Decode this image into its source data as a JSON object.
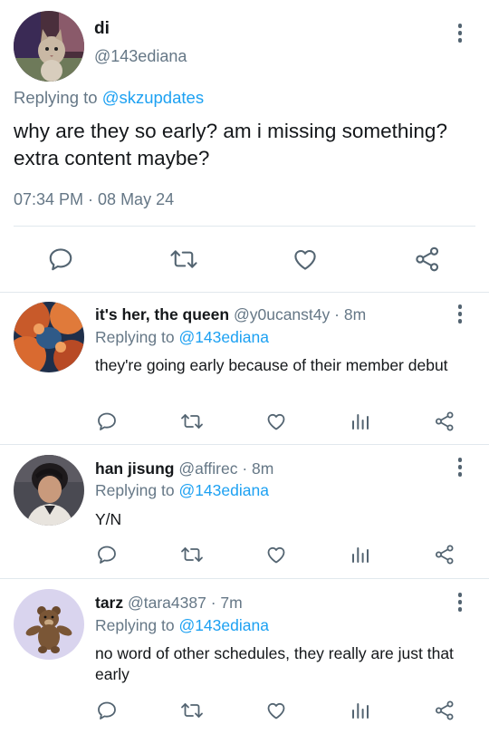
{
  "main_tweet": {
    "avatar_icon": "cat-avatar",
    "name": "di",
    "handle": "@143ediana",
    "replying_prefix": "Replying to",
    "replying_to": "@skzupdates",
    "text": "why are they so early? am i missing something? extra content maybe?",
    "time": "07:34 PM · 08 May 24",
    "actions": [
      "reply-icon",
      "retweet-icon",
      "like-icon",
      "share-icon"
    ]
  },
  "replies": [
    {
      "avatar_icon": "sunset-clouds-avatar",
      "name": "it's her, the queen",
      "handle": "@y0ucanst4y",
      "age": "· 8m",
      "replying_prefix": "Replying to",
      "replying_to": "@143ediana",
      "text": "they're going early because of their member debut"
    },
    {
      "avatar_icon": "person-avatar",
      "name": "han jisung",
      "handle": "@affirec",
      "age": "· 8m",
      "replying_prefix": "Replying to",
      "replying_to": "@143ediana",
      "text": "Y/N"
    },
    {
      "avatar_icon": "teddy-bear-avatar",
      "name": "tarz",
      "handle": "@tara4387",
      "age": "· 7m",
      "replying_prefix": "Replying to",
      "replying_to": "@143ediana",
      "text": "no word of other schedules, they really are just that early"
    }
  ],
  "colors": {
    "link": "#1da1f2",
    "secondary_text": "#657786",
    "icon": "#536471",
    "divider": "#e1e8ed"
  }
}
